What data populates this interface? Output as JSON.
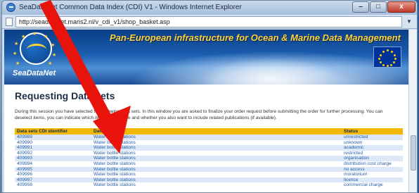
{
  "window": {
    "title": "SeaDataNet Common Data Index (CDI) V1 - Windows Internet Explorer",
    "minimize_glyph": "–",
    "maximize_glyph": "□",
    "close_glyph": "x"
  },
  "address_bar": {
    "url": "http://seadatanet.maris2.nl/v_cdi_v1/shop_basket.asp"
  },
  "banner": {
    "headline": "Pan-European infrastructure for Ocean & Marine Data Management",
    "brand": "SeaDataNet"
  },
  "page": {
    "title": "Requesting Data sets",
    "intro": "During this session you have selected the following data sets. In this window you are asked to finalize your order request before submitting the order for further processing. You can deselect items, you can indicate which items you require and whether you also want to include related publications (if available)."
  },
  "table": {
    "headers": [
      "Data sets CDI identifier",
      "Data set name",
      "Status"
    ],
    "rows": [
      [
        "409989",
        "Water bottle stations",
        "unrestricted"
      ],
      [
        "409990",
        "Water bottle stations",
        "unknown"
      ],
      [
        "409991",
        "Water bottle stations",
        "academic"
      ],
      [
        "409992",
        "Water bottle stations",
        "restricted"
      ],
      [
        "409993",
        "Water bottle stations",
        "organisation"
      ],
      [
        "409994",
        "Water bottle stations",
        "distribution cost charge"
      ],
      [
        "409995",
        "Water bottle stations",
        "no access"
      ],
      [
        "409996",
        "Water bottle stations",
        "moratorium"
      ],
      [
        "409997",
        "Water bottle stations",
        "licence"
      ],
      [
        "409998",
        "Water bottle stations",
        "commercial charge"
      ]
    ]
  },
  "colors": {
    "header_bg": "#f2b700",
    "row_alt_bg": "#dce8f7",
    "link_text": "#2860a8",
    "arrow": "#e8140c"
  }
}
